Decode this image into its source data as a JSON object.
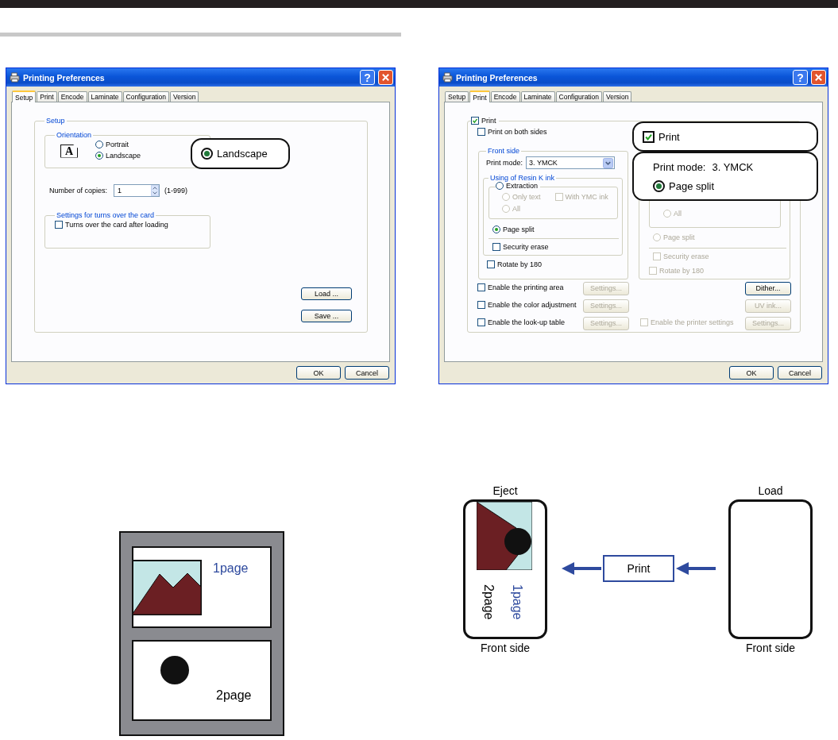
{
  "dialogs": [
    {
      "kind": "setup",
      "title": "Printing Preferences",
      "help": "?",
      "tabs": [
        {
          "label": "Setup",
          "selected": true
        },
        {
          "label": "Print",
          "selected": false
        },
        {
          "label": "Encode",
          "selected": false
        },
        {
          "label": "Laminate",
          "selected": false
        },
        {
          "label": "Configuration",
          "selected": false
        },
        {
          "label": "Version",
          "selected": false
        }
      ],
      "group_title": "Setup",
      "orientation": {
        "title": "Orientation",
        "icon_text": "A",
        "options": [
          {
            "label": "Portrait",
            "selected": false
          },
          {
            "label": "Landscape",
            "selected": true
          }
        ]
      },
      "copies": {
        "label": "Number of copies:",
        "value": "1",
        "range": "(1-999)"
      },
      "turn_over": {
        "title": "Settings for turns over the card",
        "label": "Turns over the card after loading",
        "checked": false
      },
      "side_buttons": [
        "Load ...",
        "Save ..."
      ],
      "callout": {
        "label": "Landscape",
        "selected": true
      },
      "buttons": [
        "OK",
        "Cancel"
      ]
    },
    {
      "kind": "print",
      "title": "Printing Preferences",
      "help": "?",
      "tabs": [
        {
          "label": "Setup",
          "selected": false
        },
        {
          "label": "Print",
          "selected": true
        },
        {
          "label": "Encode",
          "selected": false
        },
        {
          "label": "Laminate",
          "selected": false
        },
        {
          "label": "Configuration",
          "selected": false
        },
        {
          "label": "Version",
          "selected": false
        }
      ],
      "print": {
        "label": "Print",
        "checked": true
      },
      "both_sides": {
        "label": "Print on both sides",
        "checked": false
      },
      "front": {
        "title": "Front side",
        "mode_label": "Print mode:",
        "mode_value": "3. YMCK",
        "resin_title": "Using of Resin K ink",
        "extraction": {
          "label": "Extraction",
          "selected": false
        },
        "only_text": {
          "label": "Only text",
          "selected": false,
          "disabled": true
        },
        "with_ymc": {
          "label": "With YMC ink",
          "checked": false,
          "disabled": true
        },
        "all": {
          "label": "All",
          "selected": false,
          "disabled": true
        },
        "page_split": {
          "label": "Page split",
          "selected": true,
          "disabled": false
        },
        "security": {
          "label": "Security erase",
          "checked": false,
          "disabled": false
        },
        "rotate": {
          "label": "Rotate by 180",
          "checked": false,
          "disabled": false
        }
      },
      "back": {
        "all": {
          "label": "All",
          "selected": false,
          "disabled": true
        },
        "page_split": {
          "label": "Page split",
          "selected": false,
          "disabled": true
        },
        "security": {
          "label": "Security erase",
          "checked": false,
          "disabled": true
        },
        "rotate": {
          "label": "Rotate by 180",
          "checked": false,
          "disabled": true
        }
      },
      "options": [
        {
          "label": "Enable the printing area",
          "checked": false,
          "button": "Settings...",
          "button_disabled": true,
          "right_button": "Dither...",
          "right_disabled": false
        },
        {
          "label": "Enable the color adjustment",
          "checked": false,
          "button": "Settings...",
          "button_disabled": true,
          "right_button": "UV ink...",
          "right_disabled": true
        },
        {
          "label": "Enable the look-up table",
          "checked": false,
          "button": "Settings...",
          "button_disabled": true,
          "right_check": {
            "label": "Enable the printer settings",
            "checked": false,
            "disabled": true
          },
          "right_button": "Settings...",
          "right_disabled": true
        }
      ],
      "callout": {
        "print": {
          "label": "Print",
          "checked": true
        },
        "mode_label": "Print mode:",
        "mode_value": "3. YMCK",
        "page_split": {
          "label": "Page split",
          "selected": true
        }
      },
      "buttons": [
        "OK",
        "Cancel"
      ]
    }
  ],
  "layout_diagram": {
    "pages": [
      {
        "label": "1page",
        "kind": "image",
        "color": "#2e4a9e"
      },
      {
        "label": "2page",
        "kind": "dot",
        "color": "#000000"
      }
    ]
  },
  "flow_diagram": {
    "eject": {
      "title": "Eject",
      "caption": "Front side",
      "pages": [
        {
          "label": "2page",
          "color": "#000000"
        },
        {
          "label": "1page",
          "color": "#2e4a9e"
        }
      ]
    },
    "process": "Print",
    "load": {
      "title": "Load",
      "caption": "Front side"
    }
  }
}
